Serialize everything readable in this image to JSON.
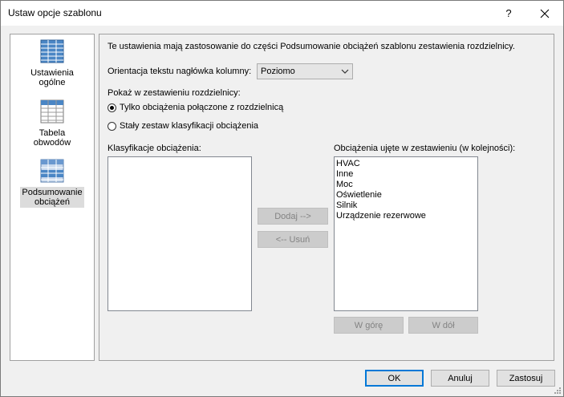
{
  "window": {
    "title": "Ustaw opcje szablonu",
    "help_label": "?",
    "close_label": "✕"
  },
  "sidebar": {
    "items": [
      {
        "label_line1": "Ustawienia",
        "label_line2": "ogólne",
        "icon": "table-settings-icon"
      },
      {
        "label_line1": "Tabela",
        "label_line2": "obwodów",
        "icon": "circuit-table-icon"
      },
      {
        "label_line1": "Podsumowanie",
        "label_line2": "obciążeń",
        "icon": "load-summary-icon",
        "selected": true
      }
    ]
  },
  "main": {
    "description": "Te ustawienia mają zastosowanie do części Podsumowanie obciążeń szablonu zestawienia rozdzielnicy.",
    "orientation_label": "Orientacja tekstu nagłówka kolumny:",
    "orientation_value": "Poziomo",
    "show_label": "Pokaż w zestawieniu rozdzielnicy:",
    "radio_connected": "Tylko obciążenia połączone z rozdzielnicą",
    "radio_fixed": "Stały zestaw klasyfikacji obciążenia",
    "classifications_label": "Klasyfikacje obciążenia:",
    "included_label": "Obciążenia ujęte w zestawieniu (w kolejności):",
    "included_items": [
      "HVAC",
      "Inne",
      "Moc",
      "Oświetlenie",
      "Silnik",
      "Urządzenie rezerwowe"
    ],
    "add_button": "Dodaj -->",
    "remove_button": "<-- Usuń",
    "up_button": "W górę",
    "down_button": "W dół"
  },
  "footer": {
    "ok": "OK",
    "cancel": "Anuluj",
    "apply": "Zastosuj"
  },
  "colors": {
    "icon_blue": "#4a86c5",
    "selection": "#dcdcdc",
    "default_button_border": "#0078d7"
  }
}
